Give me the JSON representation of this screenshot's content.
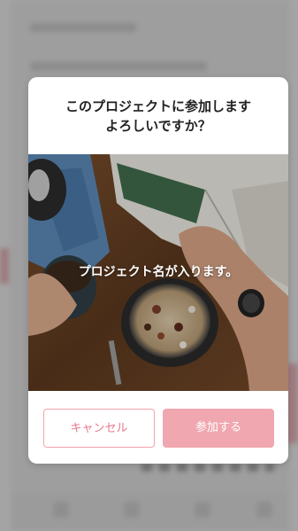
{
  "dialog": {
    "title": "このプロジェクトに参加します\nよろしいですか？",
    "project_name": "プロジェクト名が入ります。",
    "cancel_label": "キャンセル",
    "join_label": "参加する"
  },
  "colors": {
    "accent_pink": "#f0a7b0",
    "cancel_text": "#e8778a",
    "overlay": "rgba(90,90,90,0.55)"
  },
  "photo": {
    "description_icon": "project-cover-image"
  }
}
